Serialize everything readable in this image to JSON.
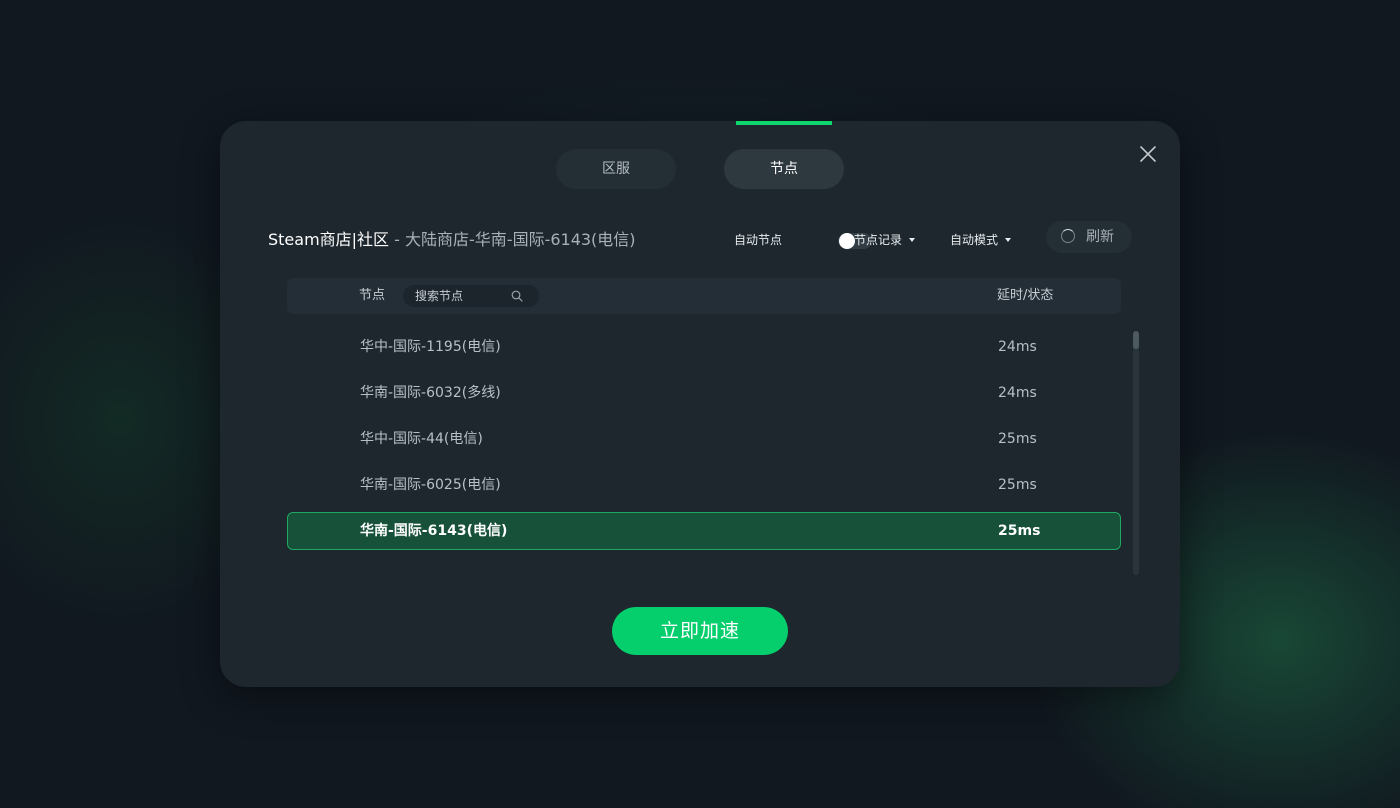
{
  "tabs": [
    {
      "label": "区服",
      "active": false
    },
    {
      "label": "节点",
      "active": true
    }
  ],
  "header": {
    "game": "Steam商店|社区",
    "separator": " - ",
    "current_node": "大陆商店-华南-国际-6143(电信)"
  },
  "controls": {
    "auto_node_label": "自动节点",
    "auto_node_on": false,
    "history_label": "节点记录",
    "mode_label": "自动模式",
    "refresh_label": "刷新"
  },
  "table": {
    "col_node": "节点",
    "search_placeholder": "搜索节点",
    "col_latency": "延时/状态",
    "rows": [
      {
        "name": "华中-国际-1195(电信)",
        "latency": "24ms",
        "selected": false
      },
      {
        "name": "华南-国际-6032(多线)",
        "latency": "24ms",
        "selected": false
      },
      {
        "name": "华中-国际-44(电信)",
        "latency": "25ms",
        "selected": false
      },
      {
        "name": "华南-国际-6025(电信)",
        "latency": "25ms",
        "selected": false
      },
      {
        "name": "华南-国际-6143(电信)",
        "latency": "25ms",
        "selected": true
      }
    ]
  },
  "actions": {
    "accelerate_label": "立即加速"
  },
  "colors": {
    "accent": "#05ce6c",
    "selected_bg": "#17513a",
    "dialog_bg": "#1e272e"
  },
  "icons": [
    "close-icon",
    "toggle-switch",
    "caret-down-icon",
    "refresh-spinner-icon",
    "search-icon"
  ]
}
